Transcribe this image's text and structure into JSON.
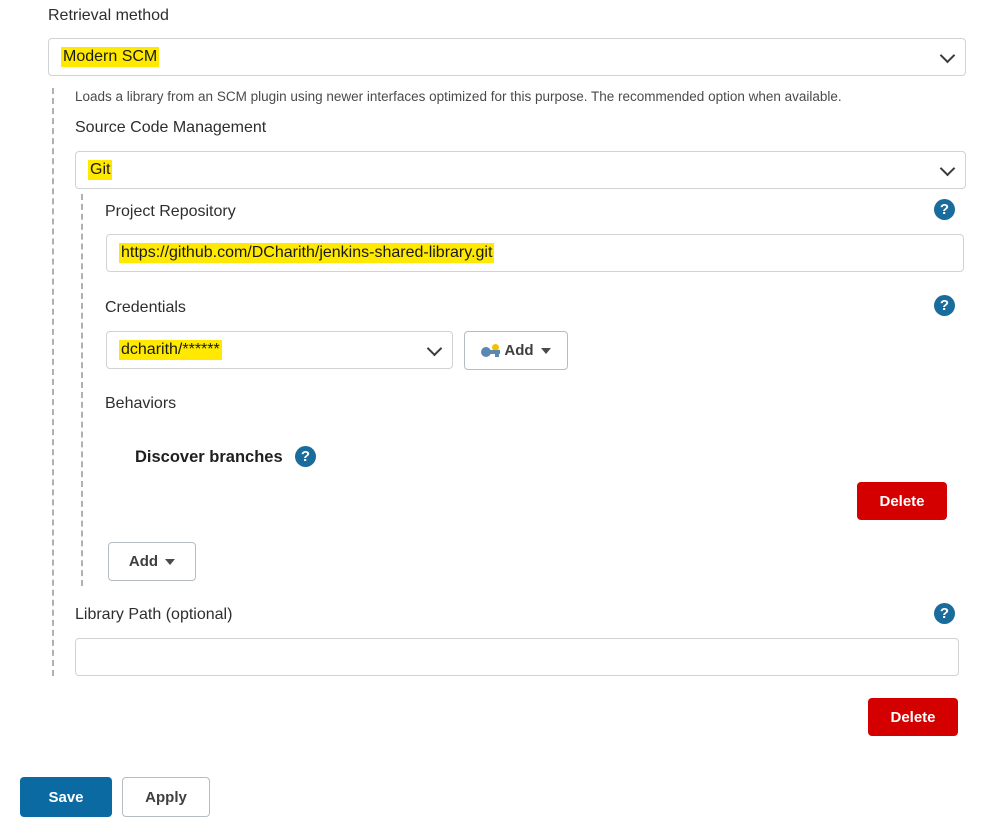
{
  "form": {
    "retrieval_method": {
      "label": "Retrieval method",
      "selected": "Modern SCM",
      "description": "Loads a library from an SCM plugin using newer interfaces optimized for this purpose. The recommended option when available."
    },
    "scm": {
      "label": "Source Code Management",
      "selected": "Git"
    },
    "project_repository": {
      "label": "Project Repository",
      "value": "https://github.com/DCharith/jenkins-shared-library.git",
      "placeholder": "",
      "help_icon": "?"
    },
    "credentials": {
      "label": "Credentials",
      "selected": "dcharith/******",
      "help_icon": "?",
      "add_button": "Add",
      "add_icon": "key-icon"
    },
    "behaviors": {
      "label": "Behaviors",
      "items": [
        {
          "title": "Discover branches",
          "help_icon": "?",
          "delete_label": "Delete"
        }
      ],
      "add_button": "Add"
    },
    "library_path": {
      "label": "Library Path (optional)",
      "value": "",
      "placeholder": "",
      "help_icon": "?"
    },
    "retriever_delete_label": "Delete"
  },
  "footer": {
    "save_label": "Save",
    "apply_label": "Apply"
  },
  "colors": {
    "highlight": "#ffe900",
    "danger": "#d40000",
    "primary": "#0b6aa2",
    "help_blue": "#1a6c9c"
  }
}
